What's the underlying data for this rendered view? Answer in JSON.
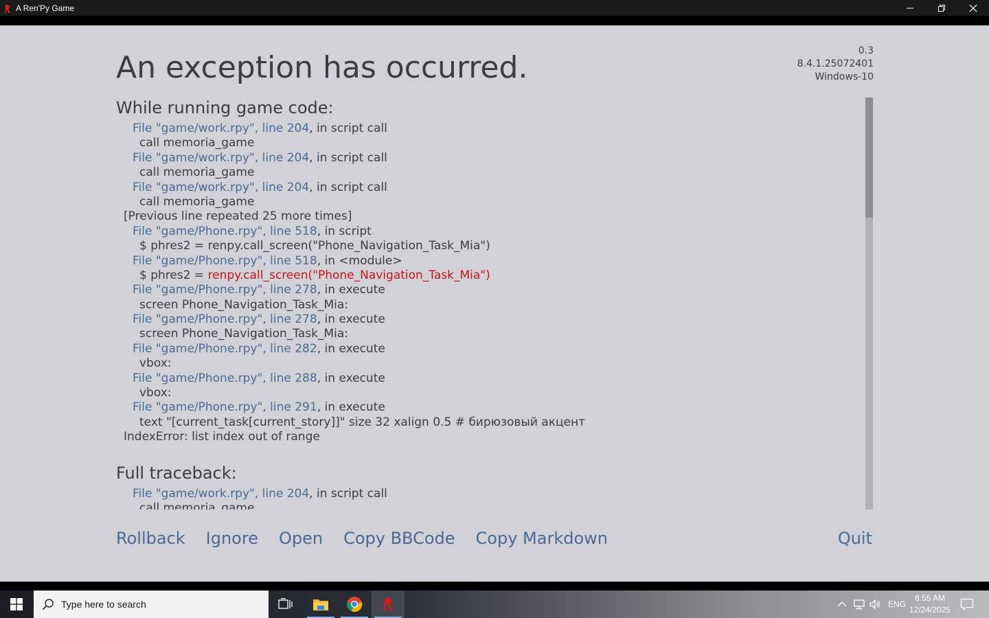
{
  "window": {
    "title": "A Ren'Py Game"
  },
  "game": {
    "heading": "An exception has occurred.",
    "version_lines": [
      "0.3",
      "8.4.1.25072401",
      "Windows-10"
    ],
    "section_running": "While running game code:",
    "section_full": "Full traceback:",
    "trace_lines": [
      {
        "kind": "file",
        "file": "File \"game/work.rpy\", line 204",
        "rest": ", in script call"
      },
      {
        "kind": "code",
        "text": "call memoria_game"
      },
      {
        "kind": "file",
        "file": "File \"game/work.rpy\", line 204",
        "rest": ", in script call"
      },
      {
        "kind": "code",
        "text": "call memoria_game"
      },
      {
        "kind": "file",
        "file": "File \"game/work.rpy\", line 204",
        "rest": ", in script call"
      },
      {
        "kind": "code",
        "text": "call memoria_game"
      },
      {
        "kind": "note",
        "text": "[Previous line repeated 25 more times]"
      },
      {
        "kind": "file",
        "file": "File \"game/Phone.rpy\", line 518",
        "rest": ", in script"
      },
      {
        "kind": "code",
        "text": "$ phres2 = renpy.call_screen(\"Phone_Navigation_Task_Mia\")"
      },
      {
        "kind": "file",
        "file": "File \"game/Phone.rpy\", line 518",
        "rest": ", in <module>"
      },
      {
        "kind": "code_err",
        "pre": "$ phres2 = ",
        "err": "renpy.call_screen(\"Phone_Navigation_Task_Mia\")"
      },
      {
        "kind": "file",
        "file": "File \"game/Phone.rpy\", line 278",
        "rest": ", in execute"
      },
      {
        "kind": "code",
        "text": "screen Phone_Navigation_Task_Mia:"
      },
      {
        "kind": "file",
        "file": "File \"game/Phone.rpy\", line 278",
        "rest": ", in execute"
      },
      {
        "kind": "code",
        "text": "screen Phone_Navigation_Task_Mia:"
      },
      {
        "kind": "file",
        "file": "File \"game/Phone.rpy\", line 282",
        "rest": ", in execute"
      },
      {
        "kind": "code",
        "text": "vbox:"
      },
      {
        "kind": "file",
        "file": "File \"game/Phone.rpy\", line 288",
        "rest": ", in execute"
      },
      {
        "kind": "code",
        "text": "vbox:"
      },
      {
        "kind": "file",
        "file": "File \"game/Phone.rpy\", line 291",
        "rest": ", in execute"
      },
      {
        "kind": "code",
        "text": "text \"[current_task[current_story]]\" size 32 xalign 0.5   # бирюзовый акцент"
      },
      {
        "kind": "note",
        "text": "IndexError: list index out of range"
      }
    ],
    "full_lines": [
      {
        "kind": "file",
        "file": "File \"game/work.rpy\", line 204",
        "rest": ", in script call"
      },
      {
        "kind": "code",
        "text": "call memoria_game"
      }
    ],
    "buttons": {
      "rollback": "Rollback",
      "ignore": "Ignore",
      "open": "Open",
      "copy_bbcode": "Copy BBCode",
      "copy_markdown": "Copy Markdown",
      "quit": "Quit"
    },
    "scroll_position": 0
  },
  "taskbar": {
    "search_placeholder": "Type here to search",
    "language": "ENG",
    "time": "8:55 AM",
    "date": "12/24/2025"
  },
  "colors": {
    "background": "#d2d1d7",
    "text": "#3d3d3d",
    "link": "#4a6a96",
    "error": "#c01818"
  }
}
